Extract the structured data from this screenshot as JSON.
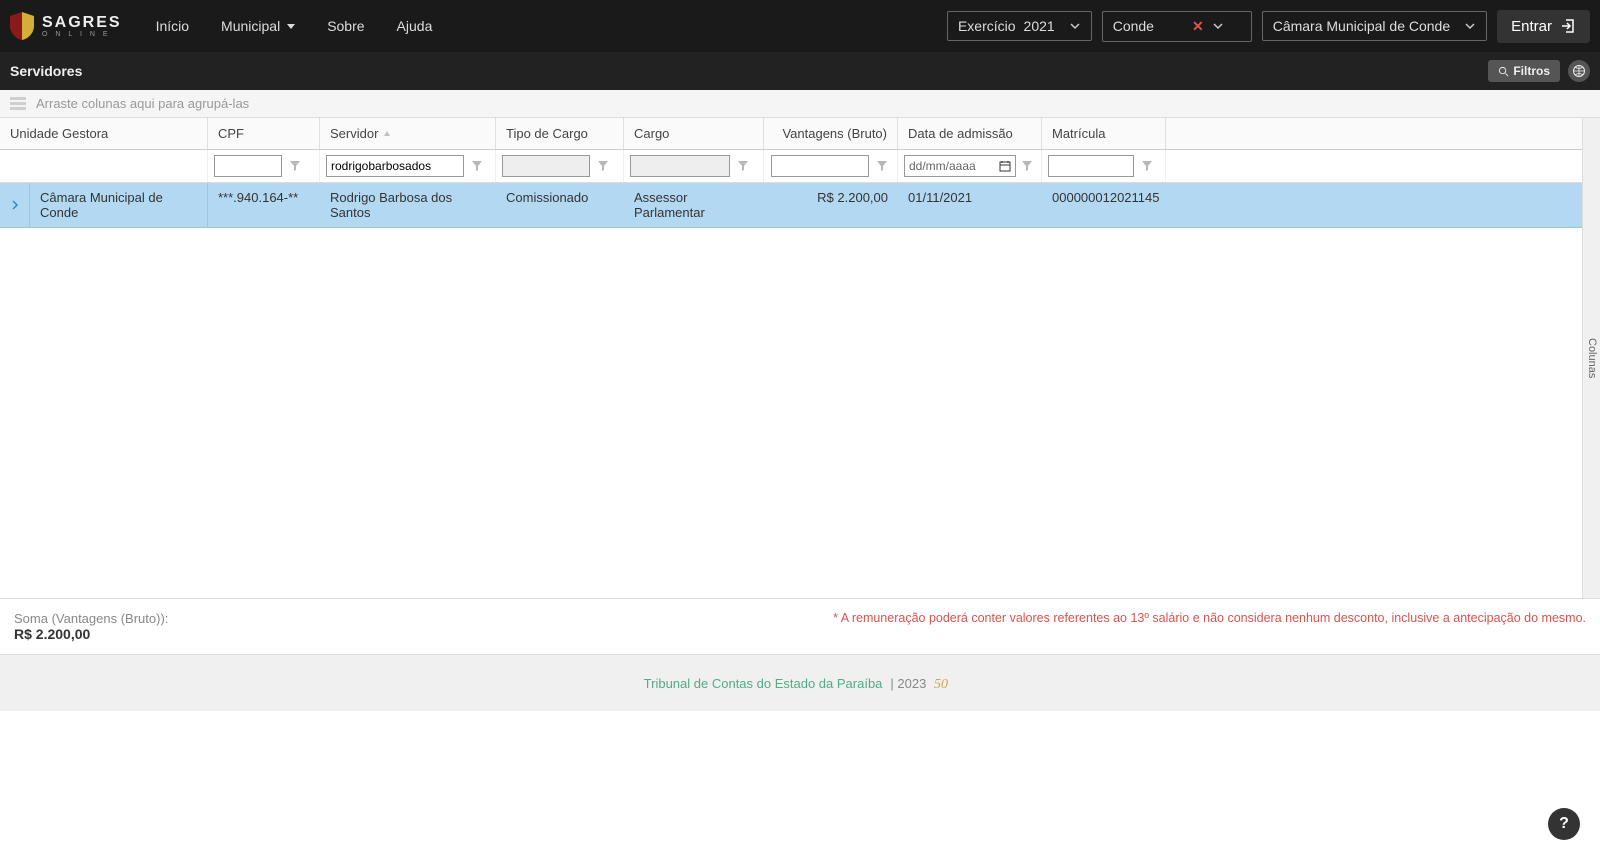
{
  "brand": {
    "name": "SAGRES",
    "sub": "O N L I N E"
  },
  "nav": {
    "inicio": "Início",
    "municipal": "Municipal",
    "sobre": "Sobre",
    "ajuda": "Ajuda"
  },
  "selectors": {
    "exercicio_label": "Exercício",
    "exercicio_year": "2021",
    "municipio": "Conde",
    "unidade": "Câmara Municipal de Conde"
  },
  "login_label": "Entrar",
  "subheader": {
    "title": "Servidores",
    "filtros": "Filtros"
  },
  "group_panel": "Arraste colunas aqui para agrupá-las",
  "columns": {
    "unidade": "Unidade Gestora",
    "cpf": "CPF",
    "servidor": "Servidor",
    "tipo": "Tipo de Cargo",
    "cargo": "Cargo",
    "vantagens": "Vantagens (Bruto)",
    "data": "Data de admissão",
    "matricula": "Matrícula"
  },
  "filters": {
    "servidor_value": "rodrigobarbosados",
    "date_placeholder": "dd/mm/aaaa"
  },
  "row": {
    "unidade": "Câmara Municipal de Conde",
    "cpf": "***.940.164-**",
    "servidor": "Rodrigo Barbosa dos Santos",
    "tipo": "Comissionado",
    "cargo": "Assessor Parlamentar",
    "vantagens": "R$ 2.200,00",
    "data": "01/11/2021",
    "matricula": "000000012021145"
  },
  "colunas_handle": "Colunas",
  "summary": {
    "label": "Soma (Vantagens (Bruto)):",
    "value": "R$ 2.200,00",
    "note": "* A remuneração poderá conter valores referentes ao 13º salário e não considera nenhum desconto, inclusive a antecipação do mesmo."
  },
  "footer": {
    "org": "Tribunal de Contas do Estado da Paraíba",
    "year": "| 2023"
  },
  "help": "?"
}
